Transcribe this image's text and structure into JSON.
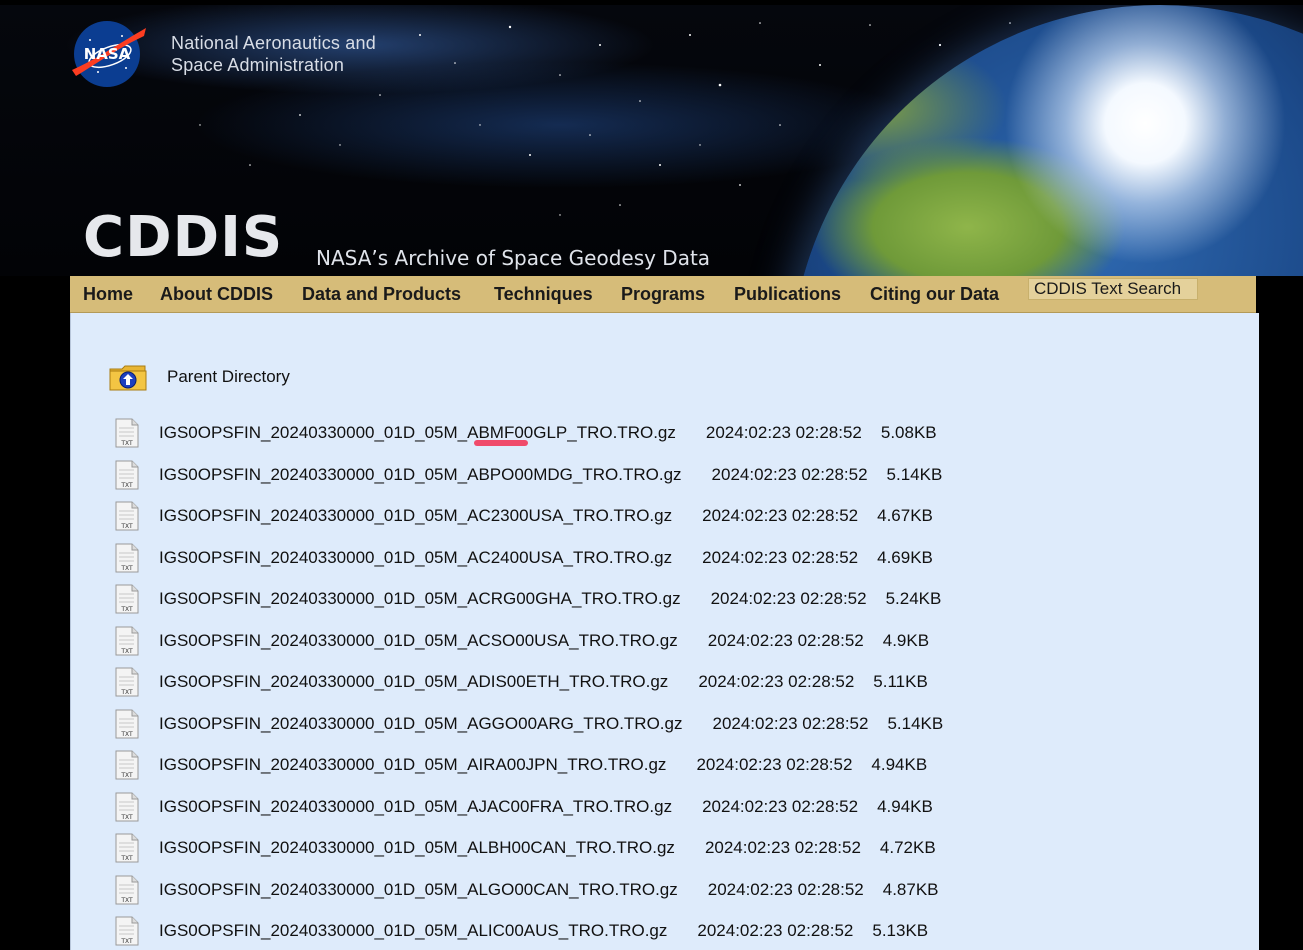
{
  "header": {
    "agency_line1": "National Aeronautics and",
    "agency_line2": "Space Administration",
    "logo_text": "NASA",
    "site_name": "CDDIS",
    "tagline": "NASA’s Archive of Space Geodesy Data"
  },
  "nav": {
    "items": [
      "Home",
      "About CDDIS",
      "Data and Products",
      "Techniques",
      "Programs",
      "Publications",
      "Citing our Data"
    ],
    "search_value": "CDDIS Text Search"
  },
  "listing": {
    "parent_label": "Parent Directory",
    "files": [
      {
        "name": "IGS0OPSFIN_20240330000_01D_05M_ABMF00GLP_TRO.TRO.gz",
        "modified": "2024:02:23 02:28:52",
        "size": "5.08KB"
      },
      {
        "name": "IGS0OPSFIN_20240330000_01D_05M_ABPO00MDG_TRO.TRO.gz",
        "modified": "2024:02:23 02:28:52",
        "size": "5.14KB"
      },
      {
        "name": "IGS0OPSFIN_20240330000_01D_05M_AC2300USA_TRO.TRO.gz",
        "modified": "2024:02:23 02:28:52",
        "size": "4.67KB"
      },
      {
        "name": "IGS0OPSFIN_20240330000_01D_05M_AC2400USA_TRO.TRO.gz",
        "modified": "2024:02:23 02:28:52",
        "size": "4.69KB"
      },
      {
        "name": "IGS0OPSFIN_20240330000_01D_05M_ACRG00GHA_TRO.TRO.gz",
        "modified": "2024:02:23 02:28:52",
        "size": "5.24KB"
      },
      {
        "name": "IGS0OPSFIN_20240330000_01D_05M_ACSO00USA_TRO.TRO.gz",
        "modified": "2024:02:23 02:28:52",
        "size": "4.9KB"
      },
      {
        "name": "IGS0OPSFIN_20240330000_01D_05M_ADIS00ETH_TRO.TRO.gz",
        "modified": "2024:02:23 02:28:52",
        "size": "5.11KB"
      },
      {
        "name": "IGS0OPSFIN_20240330000_01D_05M_AGGO00ARG_TRO.TRO.gz",
        "modified": "2024:02:23 02:28:52",
        "size": "5.14KB"
      },
      {
        "name": "IGS0OPSFIN_20240330000_01D_05M_AIRA00JPN_TRO.TRO.gz",
        "modified": "2024:02:23 02:28:52",
        "size": "4.94KB"
      },
      {
        "name": "IGS0OPSFIN_20240330000_01D_05M_AJAC00FRA_TRO.TRO.gz",
        "modified": "2024:02:23 02:28:52",
        "size": "4.94KB"
      },
      {
        "name": "IGS0OPSFIN_20240330000_01D_05M_ALBH00CAN_TRO.TRO.gz",
        "modified": "2024:02:23 02:28:52",
        "size": "4.72KB"
      },
      {
        "name": "IGS0OPSFIN_20240330000_01D_05M_ALGO00CAN_TRO.TRO.gz",
        "modified": "2024:02:23 02:28:52",
        "size": "4.87KB"
      },
      {
        "name": "IGS0OPSFIN_20240330000_01D_05M_ALIC00AUS_TRO.TRO.gz",
        "modified": "2024:02:23 02:28:52",
        "size": "5.13KB"
      }
    ],
    "file_icon_label": "TXT"
  },
  "colors": {
    "nav_bg": "#d6bc79",
    "content_bg": "#deebfb",
    "page_bg": "#000000",
    "nasa_blue": "#0b3d91",
    "nasa_red": "#fc3d21",
    "highlight_mark": "#f04a6a"
  }
}
